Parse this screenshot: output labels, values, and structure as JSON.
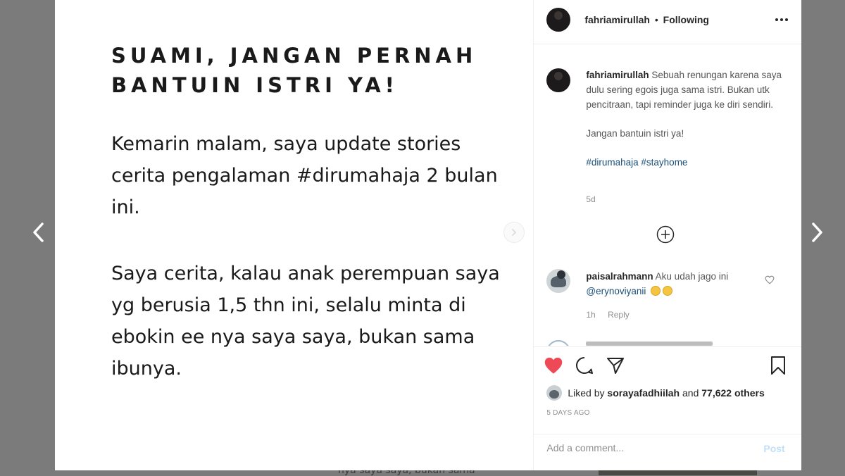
{
  "nav": {
    "prev_icon": "chevron-left-icon",
    "next_icon": "chevron-right-icon"
  },
  "post_image": {
    "title": "SUAMI, JANGAN PERNAH BANTUIN ISTRI YA!",
    "paragraph_1": "Kemarin malam, saya update stories cerita pengalaman #dirumahaja 2 bulan ini.",
    "paragraph_2": "Saya cerita, kalau anak perempuan saya yg berusia 1,5 thn ini, selalu minta di ebokin ee nya saya saya, bukan sama ibunya."
  },
  "background_bleed_text": "nya saya saya, bukan sama",
  "header": {
    "username": "fahriamirullah",
    "separator": "•",
    "follow_status": "Following"
  },
  "caption": {
    "username": "fahriamirullah",
    "text": "Sebuah renungan karena saya dulu sering egois juga sama istri. Bukan utk pencitraan, tapi reminder juga ke diri sendiri.",
    "line_2": "Jangan bantuin istri ya!",
    "hashtags": "#dirumahaja #stayhome",
    "time": "5d"
  },
  "comment": {
    "username": "paisalrahmann",
    "text": "Aku udah jago ini",
    "mention": "@erynoviyanii",
    "time": "1h",
    "reply_label": "Reply"
  },
  "likes": {
    "prefix": "Liked by",
    "user": "sorayafadhiilah",
    "middle": "and",
    "count": "77,622 others"
  },
  "post_date": "5 DAYS AGO",
  "add_comment": {
    "placeholder": "Add a comment...",
    "post_label": "Post"
  },
  "colors": {
    "like_red": "#ed4956",
    "hashtag_blue": "#1b4e78",
    "post_button_disabled": "#c2dff7"
  }
}
